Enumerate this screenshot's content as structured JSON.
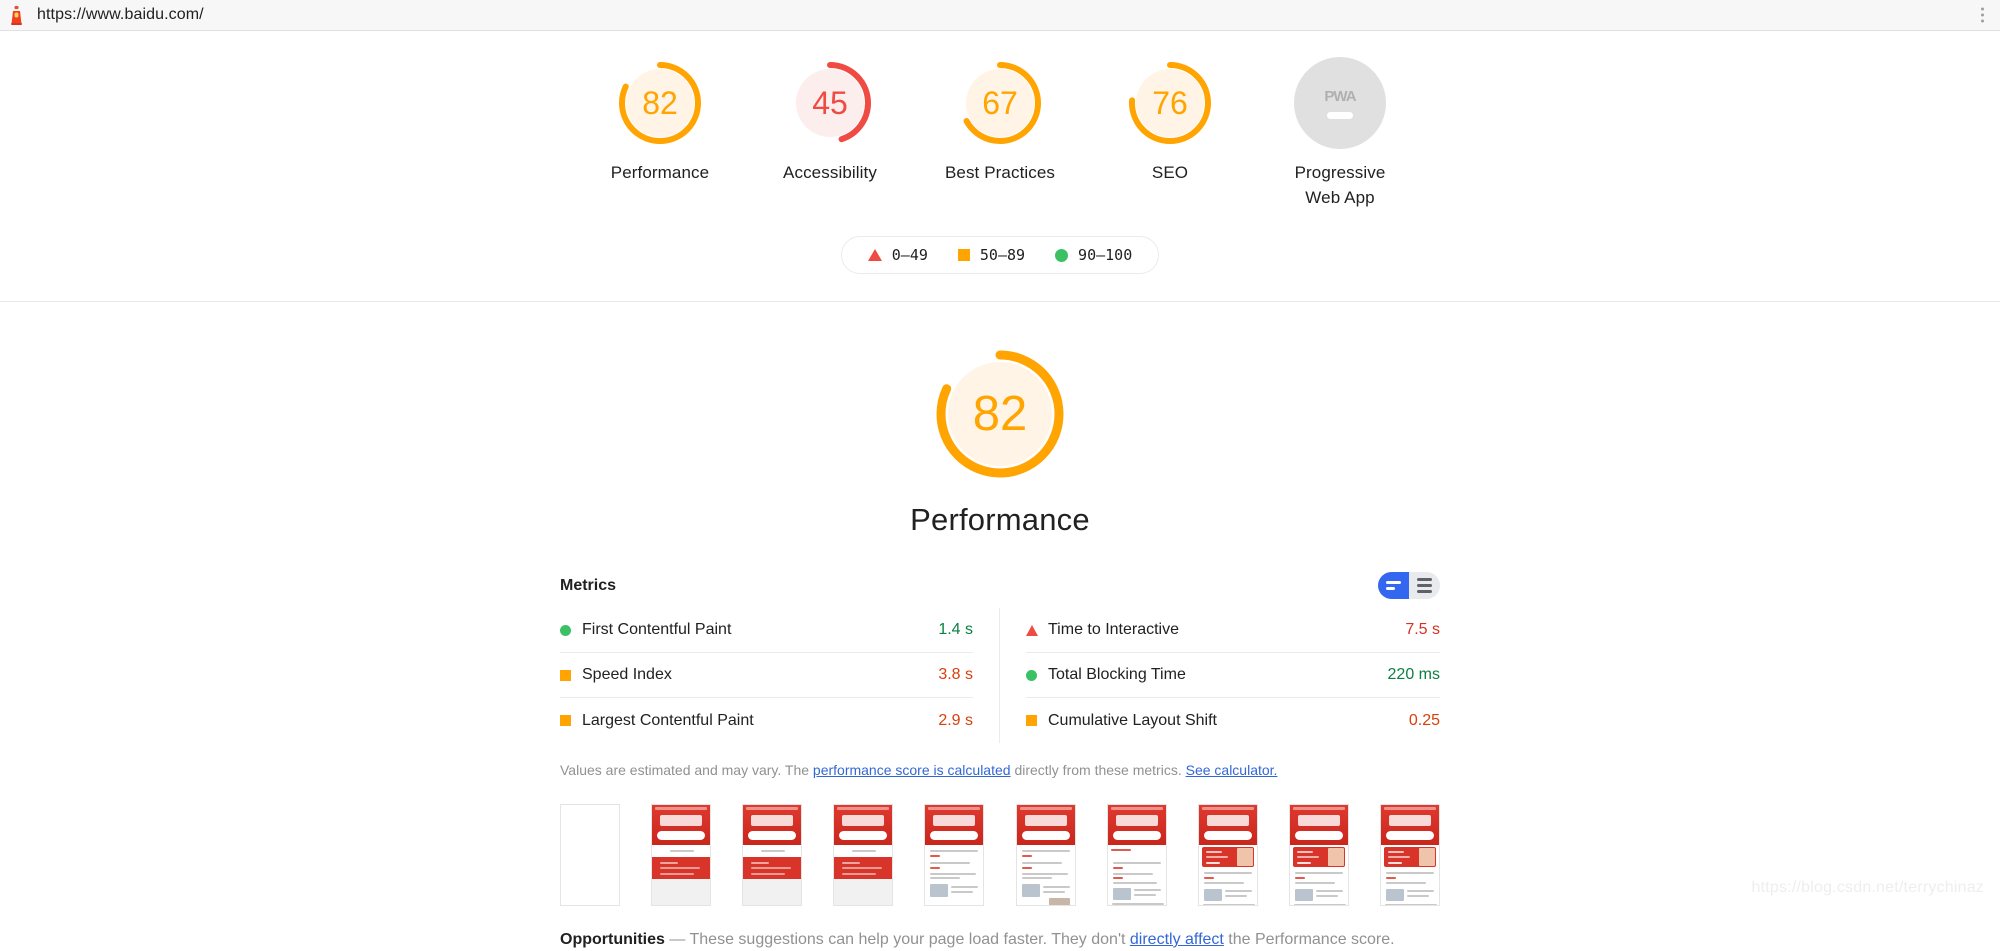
{
  "urlbar": {
    "icon": "lighthouse-icon",
    "url": "https://www.baidu.com/",
    "menu_icon": "kebab-menu-icon"
  },
  "scores": [
    {
      "value": "82",
      "label": "Performance",
      "color": "#ffa400",
      "track": "#fff4e5",
      "pct": 82,
      "type": "gauge"
    },
    {
      "value": "45",
      "label": "Accessibility",
      "color": "#f04b43",
      "track": "#fceeed",
      "pct": 45,
      "type": "gauge"
    },
    {
      "value": "67",
      "label": "Best Practices",
      "color": "#ffa400",
      "track": "#fff4e5",
      "pct": 67,
      "type": "gauge"
    },
    {
      "value": "76",
      "label": "SEO",
      "color": "#ffa400",
      "track": "#fff4e5",
      "pct": 76,
      "type": "gauge"
    },
    {
      "value": "PWA",
      "label": "Progressive Web App",
      "color": "#b0b0b0",
      "track": "#e0e0e0",
      "pct": 0,
      "type": "pwa"
    }
  ],
  "legend": {
    "items": [
      {
        "marker": "triangle",
        "range": "0–49",
        "color": "#f04b43"
      },
      {
        "marker": "square",
        "range": "50–89",
        "color": "#ffa400"
      },
      {
        "marker": "circle",
        "range": "90–100",
        "color": "#3bc164"
      }
    ]
  },
  "big_gauge": {
    "value": "82",
    "label": "Performance",
    "pct": 82,
    "color": "#ffa400",
    "track": "#fff4e5"
  },
  "metrics": {
    "title": "Metrics",
    "toggle": {
      "active": "compact-view",
      "inactive": "expanded-view"
    },
    "left": [
      {
        "name": "First Contentful Paint",
        "value": "1.4 s",
        "marker": "circle",
        "rating": "good"
      },
      {
        "name": "Speed Index",
        "value": "3.8 s",
        "marker": "square",
        "rating": "average"
      },
      {
        "name": "Largest Contentful Paint",
        "value": "2.9 s",
        "marker": "square",
        "rating": "average"
      }
    ],
    "right": [
      {
        "name": "Time to Interactive",
        "value": "7.5 s",
        "marker": "triangle",
        "rating": "bad"
      },
      {
        "name": "Total Blocking Time",
        "value": "220 ms",
        "marker": "circle",
        "rating": "good"
      },
      {
        "name": "Cumulative Layout Shift",
        "value": "0.25",
        "marker": "square",
        "rating": "average"
      }
    ],
    "disclaimer": {
      "part1": "Values are estimated and may vary. The ",
      "link1": "performance score is calculated",
      "part2": " directly from these metrics. ",
      "link2": "See calculator."
    }
  },
  "filmstrip": {
    "frames": [
      {
        "state": "blank"
      },
      {
        "state": "header-only"
      },
      {
        "state": "header-search"
      },
      {
        "state": "header-search"
      },
      {
        "state": "content-partial"
      },
      {
        "state": "content-partial"
      },
      {
        "state": "content-full"
      },
      {
        "state": "content-banner"
      },
      {
        "state": "content-banner"
      },
      {
        "state": "content-banner"
      }
    ]
  },
  "opportunities": {
    "title": "Opportunities",
    "dash": "—",
    "part1": " These suggestions can help your page load faster. They don't ",
    "link": "directly affect",
    "part2": " the Performance score."
  },
  "watermark": "https://blog.csdn.net/terrychinaz"
}
